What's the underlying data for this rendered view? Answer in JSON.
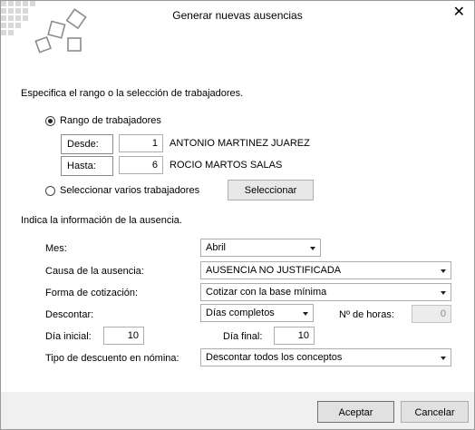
{
  "window": {
    "title": "Generar nuevas ausencias",
    "close_glyph": "✕"
  },
  "workers": {
    "heading": "Especifica el rango o la selección de trabajadores.",
    "range_option": "Rango de trabajadores",
    "from_label": "Desde:",
    "from_value": "1",
    "from_name": "ANTONIO MARTINEZ JUAREZ",
    "to_label": "Hasta:",
    "to_value": "6",
    "to_name": "ROCIO MARTOS SALAS",
    "multiple_option": "Seleccionar varios trabajadores",
    "select_button": "Seleccionar"
  },
  "absence": {
    "heading": "Indica la información de la ausencia.",
    "month_label": "Mes:",
    "month_value": "Abril",
    "cause_label": "Causa de la ausencia:",
    "cause_value": "AUSENCIA NO JUSTIFICADA",
    "contribution_label": "Forma de cotización:",
    "contribution_value": "Cotizar con la base mínima",
    "discount_label": "Descontar:",
    "discount_value": "Días completos",
    "hours_label": "Nº de horas:",
    "hours_value": "0",
    "start_day_label": "Día inicial:",
    "start_day_value": "10",
    "end_day_label": "Día final:",
    "end_day_value": "10",
    "payroll_discount_label": "Tipo de descuento en nómina:",
    "payroll_discount_value": "Descontar todos los conceptos"
  },
  "footer": {
    "accept": "Aceptar",
    "cancel": "Cancelar"
  },
  "colors": {
    "footer_bg": "#f0f0f0",
    "button_bg": "#e1e1e1",
    "accept_border": "#7a7a7a"
  }
}
